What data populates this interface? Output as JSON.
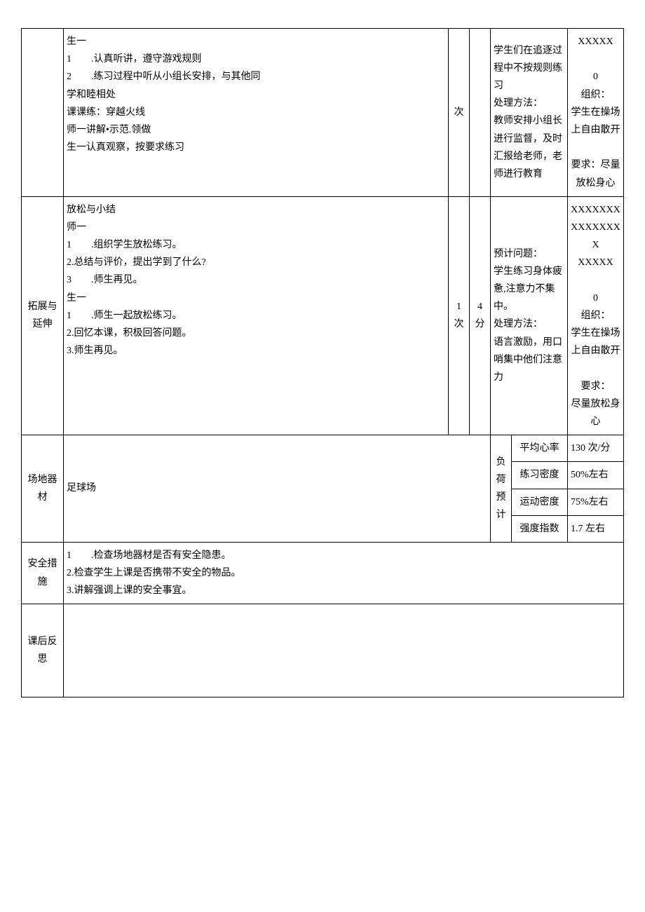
{
  "row1": {
    "content": "生一\n1  .认真听讲，遵守游戏规则\n2  .练习过程中听从小组长安排，与其他同\n学和睦相处\n课课练：穿越火线\n师一讲解•示范.领做\n生一认真观察，按要求练习",
    "ci": "次",
    "problem": "学生们在追逐过程中不按规则练习\n处理方法：\n教师安排小组长进行监督，及时汇报给老师，老师进行教育",
    "org": "XXXXX\n\n0\n组织：\n学生在操场上自由散开\n\n要求：尽量放松身心"
  },
  "row2": {
    "label": "拓展与延伸",
    "content": "放松与小结\n师一\n1  .组织学生放松练习。\n2.总结与评价，提出学到了什么?\n3  .师生再见。\n生一\n1  .师生一起放松练习。\n2.回忆本课，积极回答问题。\n3.师生再见。",
    "ci": "1\n次",
    "fen": "4\n分",
    "problem": "预计问题：\n学生练习身体疲惫,注意力不集中。\n处理方法：\n语言激励，用口哨集中他们注意力",
    "org": "XXXXXXXXXXXXXXX\nXXXXX\n\n0\n组织：\n学生在操场上自由散开\n\n要求：\n尽量放松身心"
  },
  "equip": {
    "label": "场地器材",
    "value": "足球场",
    "loadLabel": "负荷预计",
    "rows": [
      {
        "name": "平均心率",
        "val": "130 次/分"
      },
      {
        "name": "练习密度",
        "val": "50%左右"
      },
      {
        "name": "运动密度",
        "val": "75%左右"
      },
      {
        "name": "强度指数",
        "val": "1.7 左右"
      }
    ]
  },
  "safety": {
    "label": "安全措施",
    "content": "1  .检查场地器材是否有安全隐患。\n2.检查学生上课是否携带不安全的物品。\n3.讲解强调上课的安全事宜。"
  },
  "reflect": {
    "label": "课后反思",
    "content": ""
  }
}
